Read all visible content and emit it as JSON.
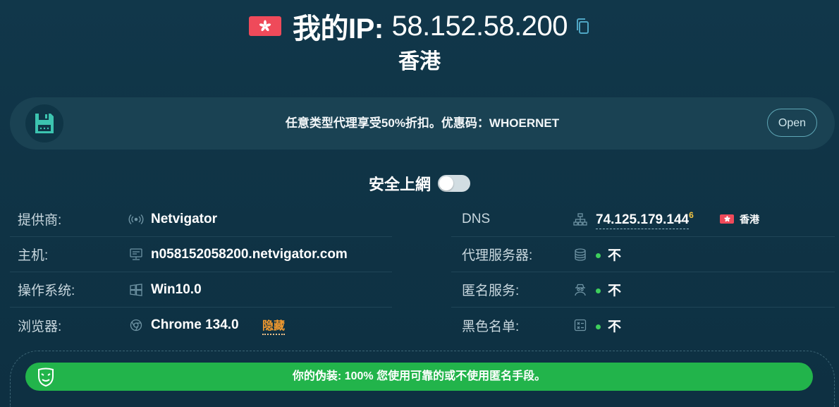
{
  "header": {
    "ip_label": "我的IP:",
    "ip_value": "58.152.58.200",
    "country": "香港",
    "flag_icon": "hong-kong-flag-icon",
    "copy_icon": "copy-icon"
  },
  "promo": {
    "icon": "floppy-disk-icon",
    "text": "任意类型代理享受50%折扣。优惠码：WHOERNET",
    "button_label": "Open"
  },
  "safe_toggle": {
    "label": "安全上網",
    "enabled": false
  },
  "left_rows": [
    {
      "label": "提供商:",
      "icon": "antenna-icon",
      "value": "Netvigator"
    },
    {
      "label": "主机:",
      "icon": "server-icon",
      "value": "n058152058200.netvigator.com"
    },
    {
      "label": "操作系统:",
      "icon": "windows-icon",
      "value": "Win10.0"
    },
    {
      "label": "浏览器:",
      "icon": "chrome-icon",
      "value": "Chrome 134.0",
      "extra": "隐藏"
    }
  ],
  "right_rows": [
    {
      "label": "DNS",
      "icon": "network-icon",
      "value": "74.125.179.144",
      "sup": "6",
      "country": "香港"
    },
    {
      "label": "代理服务器:",
      "icon": "database-icon",
      "value": "不"
    },
    {
      "label": "匿名服务:",
      "icon": "anonymous-user-icon",
      "value": "不"
    },
    {
      "label": "黑色名单:",
      "icon": "blacklist-icon",
      "value": "不"
    }
  ],
  "disguise": {
    "icon": "mask-icon",
    "text": "你的伪装: 100% 您使用可靠的或不使用匿名手段。"
  },
  "colors": {
    "background": "#11374a",
    "accent_green": "#22b44b",
    "flag_red": "#ef4a5a",
    "warning_orange": "#f39a2e"
  }
}
